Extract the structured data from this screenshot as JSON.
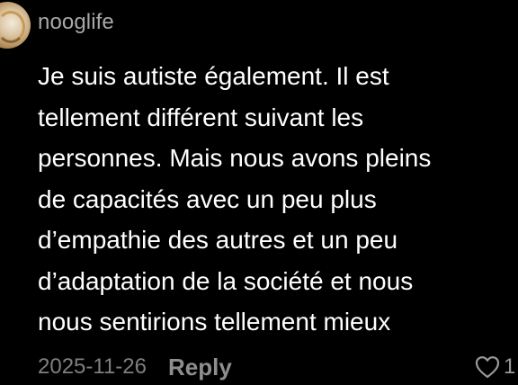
{
  "comment": {
    "username": "nooglife",
    "avatar_icon": "avatar-image",
    "text_lines": [
      "Je suis autiste également. Il est",
      "tellement différent suivant les",
      "personnes. Mais nous avons pleins",
      "de capacités avec un peu plus",
      "d’empathie des autres et un peu",
      "d’adaptation de la société et nous",
      "nous sentirions tellement mieux"
    ],
    "date": "2025-11-26",
    "reply_label": "Reply",
    "like_icon": "heart-icon",
    "like_count": "1"
  },
  "colors": {
    "background": "#000000",
    "text": "#ffffff",
    "username": "#a8a8a8",
    "meta": "#7f7f7f"
  }
}
